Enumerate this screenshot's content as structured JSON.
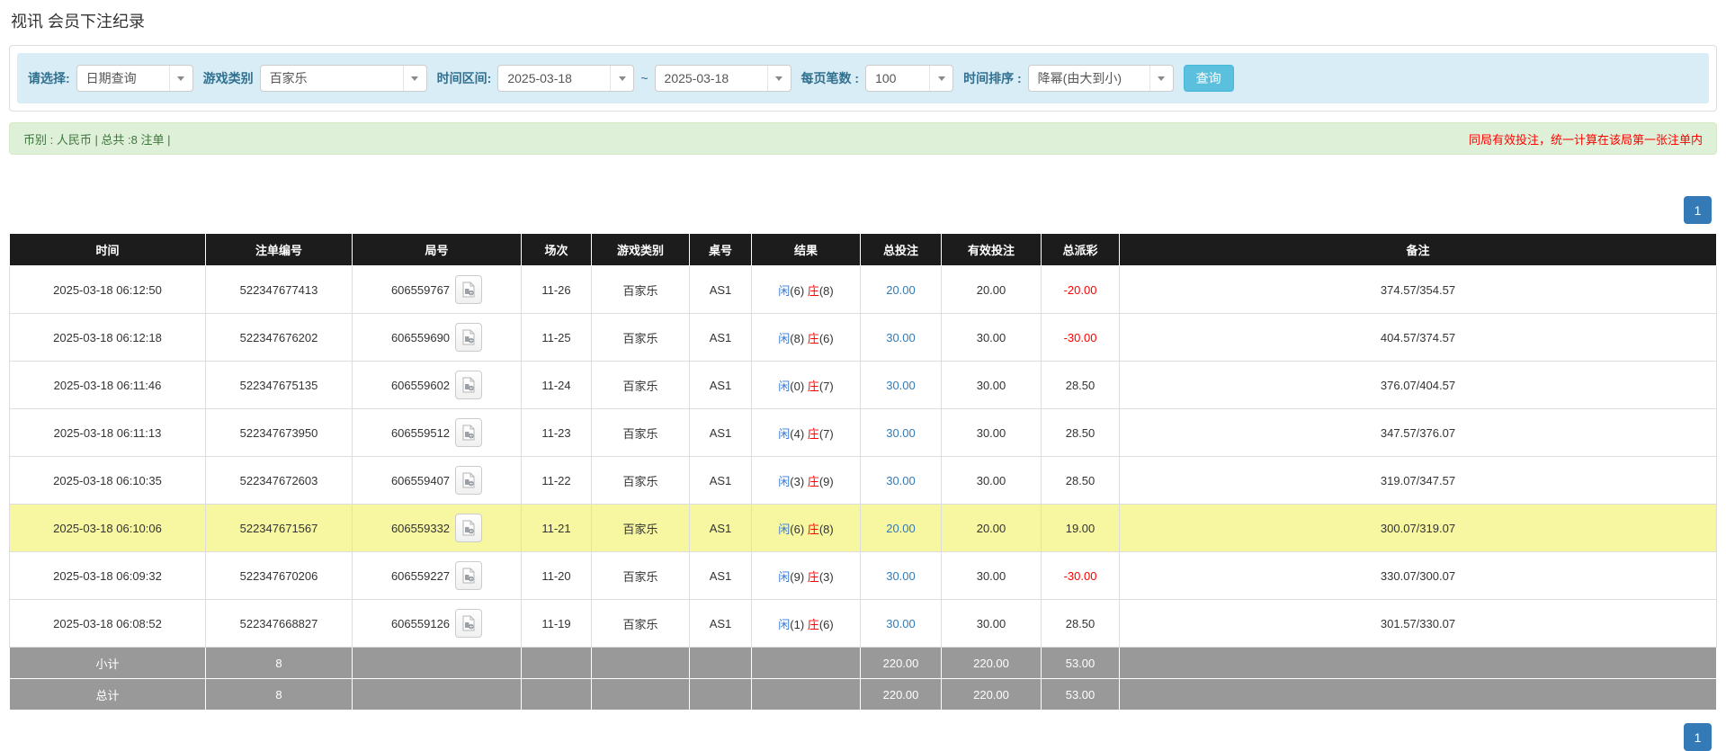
{
  "page": {
    "title": "视讯 会员下注纪录"
  },
  "filter": {
    "select_type": {
      "label": "请选择:",
      "value": "日期查询"
    },
    "game_category": {
      "label": "游戏类别",
      "value": "百家乐"
    },
    "time_range": {
      "label": "时间区间:",
      "from": "2025-03-18",
      "separator": "~",
      "to": "2025-03-18"
    },
    "page_size": {
      "label": "每页笔数 :",
      "value": "100"
    },
    "time_order": {
      "label": "时间排序 :",
      "value": "降幂(由大到小)"
    },
    "query_button": "查询"
  },
  "info_bar": {
    "summary": "币别 : 人民币 | 总共 :8 注单 |",
    "notice": "同局有效投注，统一计算在该局第一张注单内"
  },
  "pagination": {
    "current_page": "1"
  },
  "table": {
    "headers": [
      "时间",
      "注单编号",
      "局号",
      "场次",
      "游戏类别",
      "桌号",
      "结果",
      "总投注",
      "有效投注",
      "总派彩",
      "备注"
    ],
    "result_labels": {
      "player": "闲",
      "banker": "庄"
    },
    "rows": [
      {
        "time": "2025-03-18 06:12:50",
        "bet_id": "522347677413",
        "round_id": "606559767",
        "session": "11-26",
        "game": "百家乐",
        "table_no": "AS1",
        "result": {
          "player": "6",
          "banker": "8"
        },
        "total_bet": "20.00",
        "valid_bet": "20.00",
        "payout": "-20.00",
        "remark": "374.57/354.57",
        "highlighted": false
      },
      {
        "time": "2025-03-18 06:12:18",
        "bet_id": "522347676202",
        "round_id": "606559690",
        "session": "11-25",
        "game": "百家乐",
        "table_no": "AS1",
        "result": {
          "player": "8",
          "banker": "6"
        },
        "total_bet": "30.00",
        "valid_bet": "30.00",
        "payout": "-30.00",
        "remark": "404.57/374.57",
        "highlighted": false
      },
      {
        "time": "2025-03-18 06:11:46",
        "bet_id": "522347675135",
        "round_id": "606559602",
        "session": "11-24",
        "game": "百家乐",
        "table_no": "AS1",
        "result": {
          "player": "0",
          "banker": "7"
        },
        "total_bet": "30.00",
        "valid_bet": "30.00",
        "payout": "28.50",
        "remark": "376.07/404.57",
        "highlighted": false
      },
      {
        "time": "2025-03-18 06:11:13",
        "bet_id": "522347673950",
        "round_id": "606559512",
        "session": "11-23",
        "game": "百家乐",
        "table_no": "AS1",
        "result": {
          "player": "4",
          "banker": "7"
        },
        "total_bet": "30.00",
        "valid_bet": "30.00",
        "payout": "28.50",
        "remark": "347.57/376.07",
        "highlighted": false
      },
      {
        "time": "2025-03-18 06:10:35",
        "bet_id": "522347672603",
        "round_id": "606559407",
        "session": "11-22",
        "game": "百家乐",
        "table_no": "AS1",
        "result": {
          "player": "3",
          "banker": "9"
        },
        "total_bet": "30.00",
        "valid_bet": "30.00",
        "payout": "28.50",
        "remark": "319.07/347.57",
        "highlighted": false
      },
      {
        "time": "2025-03-18 06:10:06",
        "bet_id": "522347671567",
        "round_id": "606559332",
        "session": "11-21",
        "game": "百家乐",
        "table_no": "AS1",
        "result": {
          "player": "6",
          "banker": "8"
        },
        "total_bet": "20.00",
        "valid_bet": "20.00",
        "payout": "19.00",
        "remark": "300.07/319.07",
        "highlighted": true
      },
      {
        "time": "2025-03-18 06:09:32",
        "bet_id": "522347670206",
        "round_id": "606559227",
        "session": "11-20",
        "game": "百家乐",
        "table_no": "AS1",
        "result": {
          "player": "9",
          "banker": "3"
        },
        "total_bet": "30.00",
        "valid_bet": "30.00",
        "payout": "-30.00",
        "remark": "330.07/300.07",
        "highlighted": false
      },
      {
        "time": "2025-03-18 06:08:52",
        "bet_id": "522347668827",
        "round_id": "606559126",
        "session": "11-19",
        "game": "百家乐",
        "table_no": "AS1",
        "result": {
          "player": "1",
          "banker": "6"
        },
        "total_bet": "30.00",
        "valid_bet": "30.00",
        "payout": "28.50",
        "remark": "301.57/330.07",
        "highlighted": false
      }
    ],
    "summary_rows": [
      {
        "label": "小计",
        "count": "8",
        "total_bet": "220.00",
        "valid_bet": "220.00",
        "payout": "53.00"
      },
      {
        "label": "总计",
        "count": "8",
        "total_bet": "220.00",
        "valid_bet": "220.00",
        "payout": "53.00"
      }
    ]
  },
  "colors": {
    "accent_blue": "#337ab7",
    "query_button_bg": "#5bc0de",
    "player_blue": "#3a7bd5",
    "banker_red": "#ff0000",
    "negative_red": "#ff0000",
    "highlight_yellow": "#f7f7a1",
    "header_bg": "#1c1c1c",
    "summary_bg": "#999999",
    "filter_bg": "#d9edf7",
    "filter_label": "#31708f",
    "info_bg": "#dff0d8",
    "info_text": "#3c763d"
  }
}
